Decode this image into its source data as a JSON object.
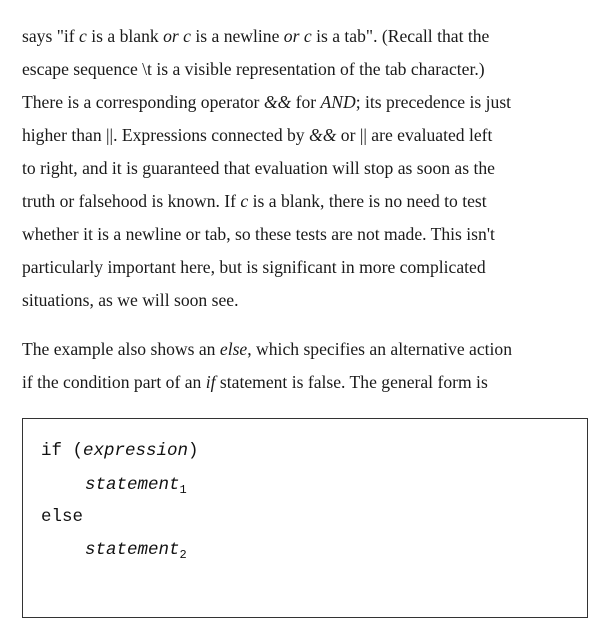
{
  "paragraph1": {
    "l1": {
      "a": "says \"if ",
      "b": "c",
      "c": " is a blank ",
      "d": "or",
      "e": " ",
      "f": "c",
      "g": " is a newline ",
      "h": "or",
      "i": " ",
      "j": "c",
      "k": " is a tab\". (Recall that the"
    },
    "l2": "escape sequence \\t is a visible representation of the tab character.)",
    "l3": {
      "a": "There is a corresponding operator ",
      "b": "&&",
      "c": " for ",
      "d": "AND",
      "e": "; its precedence is just"
    },
    "l4": {
      "a": "higher than ||. Expressions connected by ",
      "b": "&&",
      "c": " or || are evaluated left"
    },
    "l5": "to right, and it is guaranteed that evaluation will stop as soon as the",
    "l6": {
      "a": "truth or falsehood is known. If ",
      "b": "c",
      "c": " is a blank, there is no need to test"
    },
    "l7": "whether it is a newline or tab, so these tests are not made. This isn't",
    "l8": "particularly important here, but is significant in more complicated",
    "l9": "situations, as we will soon see."
  },
  "paragraph2": {
    "l1": {
      "a": "The example also shows an ",
      "b": "else",
      "c": ", which specifies an alternative action"
    },
    "l2": {
      "a": "if the condition part of an ",
      "b": "if",
      "c": " statement is false. The general form is"
    }
  },
  "code": {
    "if_kw": "if (",
    "expr": "expression",
    "close_paren": ")",
    "stmt1": "statement",
    "sub1": "1",
    "else_kw": "else",
    "stmt2": "statement",
    "sub2": "2"
  }
}
